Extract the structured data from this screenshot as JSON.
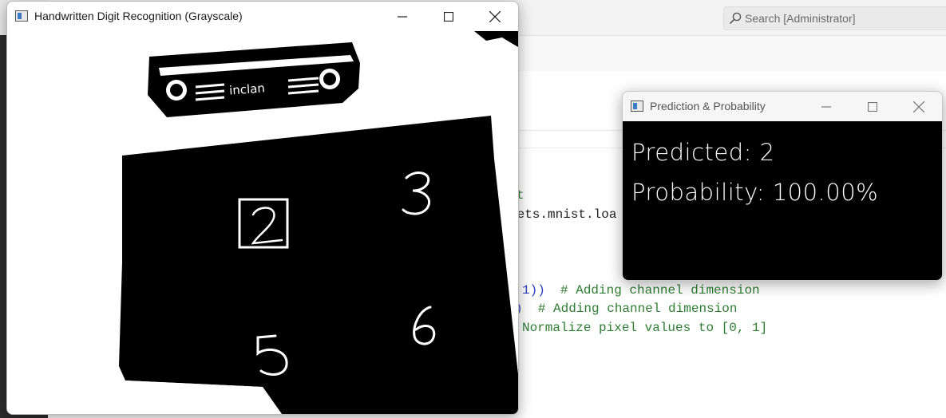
{
  "ide": {
    "search_placeholder": "Search [Administrator]",
    "code_lines": [
      {
        "text": "t",
        "color": "green"
      },
      {
        "text": "sets.mnist.loa",
        "color": "black"
      },
      {
        "text": "1))  # Adding channel dimension",
        "color": "mixed1"
      },
      {
        "text": ")  # Adding channel dimension",
        "color": "mixed2"
      },
      {
        "text": "Normalize pixel values to [0, 1]",
        "color": "green"
      }
    ]
  },
  "digit_window": {
    "title": "Handwritten Digit Recognition (Grayscale)",
    "detected_digits": [
      "2",
      "3",
      "5",
      "6"
    ],
    "device_label": "inclan"
  },
  "prediction_window": {
    "title": "Prediction & Probability",
    "predicted_label": "Predicted:",
    "predicted_value": "2",
    "probability_label": "Probability:",
    "probability_value": "100.00%"
  },
  "controls": {
    "minimize": "minimize-icon",
    "maximize": "maximize-icon",
    "close": "close-icon"
  }
}
